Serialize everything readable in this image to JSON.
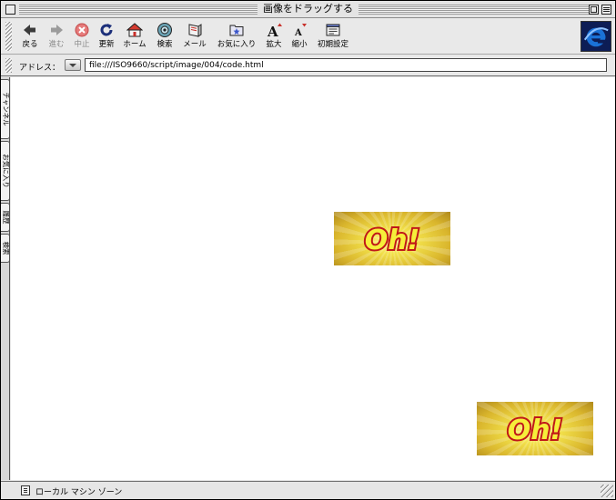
{
  "window": {
    "title": "画像をドラッグする"
  },
  "toolbar": {
    "buttons": [
      {
        "id": "back",
        "label": "戻る",
        "icon": "back-arrow-icon",
        "enabled": true
      },
      {
        "id": "forward",
        "label": "進む",
        "icon": "forward-arrow-icon",
        "enabled": false
      },
      {
        "id": "stop",
        "label": "中止",
        "icon": "stop-icon",
        "enabled": false
      },
      {
        "id": "refresh",
        "label": "更新",
        "icon": "refresh-icon",
        "enabled": true
      },
      {
        "id": "home",
        "label": "ホーム",
        "icon": "home-icon",
        "enabled": true
      },
      {
        "id": "search",
        "label": "検索",
        "icon": "search-icon",
        "enabled": true
      },
      {
        "id": "mail",
        "label": "メール",
        "icon": "mail-icon",
        "enabled": true
      },
      {
        "id": "favorites",
        "label": "お気に入り",
        "icon": "favorites-icon",
        "enabled": true
      },
      {
        "id": "larger",
        "label": "拡大",
        "icon": "text-larger-icon",
        "enabled": true
      },
      {
        "id": "smaller",
        "label": "縮小",
        "icon": "text-smaller-icon",
        "enabled": true
      },
      {
        "id": "preferences",
        "label": "初期設定",
        "icon": "preferences-icon",
        "enabled": true
      }
    ]
  },
  "address": {
    "label": "アドレス：",
    "value": "file:///ISO9660/script/image/004/code.html"
  },
  "sidetabs": [
    {
      "label": "チャンネル"
    },
    {
      "label": "お気に入り"
    },
    {
      "label": "履歴"
    },
    {
      "label": "検索"
    }
  ],
  "content": {
    "images": [
      {
        "text": "Oh!"
      },
      {
        "text": "Oh!"
      }
    ]
  },
  "status": {
    "zone": "ローカル マシン ゾーン"
  },
  "colors": {
    "content_bg": "#ffffff",
    "chrome_bg": "#e6e6e6",
    "oh_fill": "#f6ee3a",
    "oh_outline": "#c01818",
    "ie_blue": "#1a72d8"
  }
}
